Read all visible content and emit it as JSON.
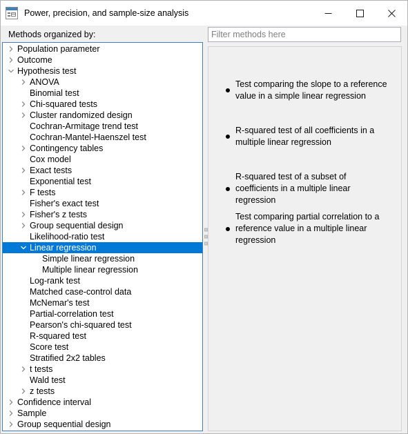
{
  "window": {
    "title": "Power, precision, and sample-size analysis",
    "app_icon": "form-window-icon",
    "controls": {
      "minimize": "minimize-button",
      "maximize": "maximize-button",
      "close": "close-button"
    }
  },
  "left": {
    "label": "Methods organized by:",
    "tree": [
      {
        "label": "Population parameter",
        "level": 0,
        "state": "collapsed",
        "selected": false
      },
      {
        "label": "Outcome",
        "level": 0,
        "state": "collapsed",
        "selected": false
      },
      {
        "label": "Hypothesis test",
        "level": 0,
        "state": "expanded",
        "selected": false
      },
      {
        "label": "ANOVA",
        "level": 1,
        "state": "collapsed",
        "selected": false
      },
      {
        "label": "Binomial test",
        "level": 1,
        "state": "leaf",
        "selected": false
      },
      {
        "label": "Chi-squared tests",
        "level": 1,
        "state": "collapsed",
        "selected": false
      },
      {
        "label": "Cluster randomized design",
        "level": 1,
        "state": "collapsed",
        "selected": false
      },
      {
        "label": "Cochran-Armitage trend test",
        "level": 1,
        "state": "leaf",
        "selected": false
      },
      {
        "label": "Cochran-Mantel-Haenszel test",
        "level": 1,
        "state": "leaf",
        "selected": false
      },
      {
        "label": "Contingency tables",
        "level": 1,
        "state": "collapsed",
        "selected": false
      },
      {
        "label": "Cox model",
        "level": 1,
        "state": "leaf",
        "selected": false
      },
      {
        "label": "Exact tests",
        "level": 1,
        "state": "collapsed",
        "selected": false
      },
      {
        "label": "Exponential test",
        "level": 1,
        "state": "leaf",
        "selected": false
      },
      {
        "label": "F tests",
        "level": 1,
        "state": "collapsed",
        "selected": false
      },
      {
        "label": "Fisher's exact test",
        "level": 1,
        "state": "leaf",
        "selected": false
      },
      {
        "label": "Fisher's z tests",
        "level": 1,
        "state": "collapsed",
        "selected": false
      },
      {
        "label": "Group sequential design",
        "level": 1,
        "state": "collapsed",
        "selected": false
      },
      {
        "label": "Likelihood-ratio test",
        "level": 1,
        "state": "leaf",
        "selected": false
      },
      {
        "label": "Linear regression",
        "level": 1,
        "state": "expanded",
        "selected": true
      },
      {
        "label": "Simple linear regression",
        "level": 2,
        "state": "leaf",
        "selected": false
      },
      {
        "label": "Multiple linear regression",
        "level": 2,
        "state": "leaf",
        "selected": false
      },
      {
        "label": "Log-rank test",
        "level": 1,
        "state": "leaf",
        "selected": false
      },
      {
        "label": "Matched case-control data",
        "level": 1,
        "state": "leaf",
        "selected": false
      },
      {
        "label": "McNemar's test",
        "level": 1,
        "state": "leaf",
        "selected": false
      },
      {
        "label": "Partial-correlation test",
        "level": 1,
        "state": "leaf",
        "selected": false
      },
      {
        "label": "Pearson's chi-squared test",
        "level": 1,
        "state": "leaf",
        "selected": false
      },
      {
        "label": "R-squared test",
        "level": 1,
        "state": "leaf",
        "selected": false
      },
      {
        "label": "Score test",
        "level": 1,
        "state": "leaf",
        "selected": false
      },
      {
        "label": "Stratified 2x2 tables",
        "level": 1,
        "state": "leaf",
        "selected": false
      },
      {
        "label": "t tests",
        "level": 1,
        "state": "collapsed",
        "selected": false
      },
      {
        "label": "Wald test",
        "level": 1,
        "state": "leaf",
        "selected": false
      },
      {
        "label": "z tests",
        "level": 1,
        "state": "collapsed",
        "selected": false
      },
      {
        "label": "Confidence interval",
        "level": 0,
        "state": "collapsed",
        "selected": false
      },
      {
        "label": "Sample",
        "level": 0,
        "state": "collapsed",
        "selected": false
      },
      {
        "label": "Group sequential design",
        "level": 0,
        "state": "collapsed",
        "selected": false
      }
    ]
  },
  "splitter": {
    "name": "panel-splitter",
    "grip_dots": 3
  },
  "right": {
    "filter": {
      "placeholder": "Filter methods here",
      "value": ""
    },
    "results": [
      {
        "text": "Test comparing the slope to a reference value in a simple linear regression"
      },
      {
        "text": "R-squared test of all coefficients in a multiple linear regression"
      },
      {
        "text": "R-squared test of a subset of coefficients in a multiple linear regression"
      },
      {
        "text": "Test comparing partial correlation to a reference value in a multiple linear regression"
      }
    ]
  },
  "colors": {
    "selection": "#0078d7",
    "focus_border": "#3f7fbf",
    "panel_bg": "#f0f0f0",
    "tree_bg": "#ffffff"
  }
}
